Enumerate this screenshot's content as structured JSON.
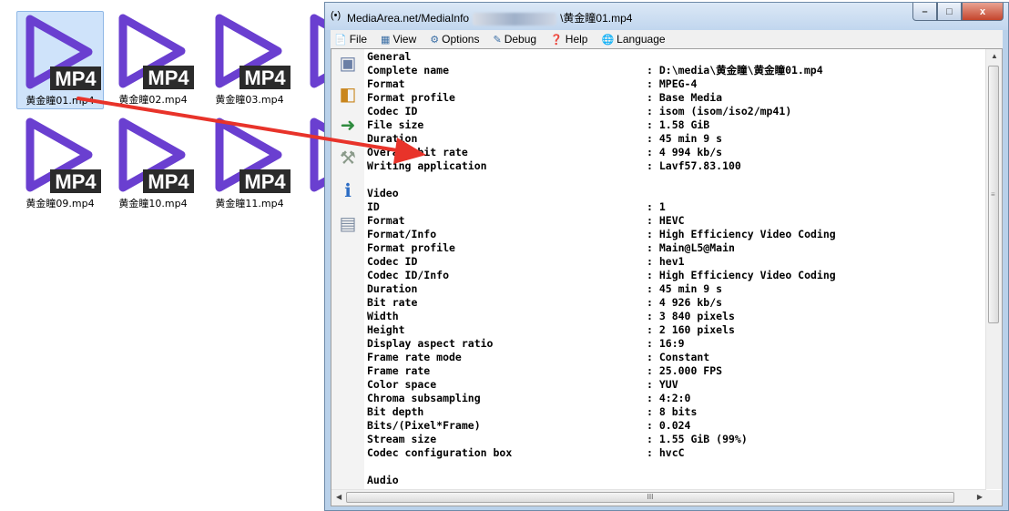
{
  "desktop": {
    "files": [
      {
        "name": "黄金瞳01.mp4",
        "badge": "MP4",
        "selected": true
      },
      {
        "name": "黄金瞳02.mp4",
        "badge": "MP4",
        "selected": false
      },
      {
        "name": "黄金瞳03.mp4",
        "badge": "MP4",
        "selected": false
      },
      {
        "name": "黄",
        "badge": "MP4",
        "selected": false
      },
      {
        "name": "黄金瞳09.mp4",
        "badge": "MP4",
        "selected": false
      },
      {
        "name": "黄金瞳10.mp4",
        "badge": "MP4",
        "selected": false
      },
      {
        "name": "黄金瞳11.mp4",
        "badge": "MP4",
        "selected": false
      },
      {
        "name": "黄",
        "badge": "MP4",
        "selected": false
      }
    ]
  },
  "window": {
    "title_prefix": "MediaArea.net/MediaInfo",
    "title_suffix": "\\黄金瞳01.mp4",
    "controls": {
      "minimize": "–",
      "maximize": "□",
      "close": "x"
    }
  },
  "menu": [
    {
      "label": "File",
      "icon": "file-icon"
    },
    {
      "label": "View",
      "icon": "view-icon"
    },
    {
      "label": "Options",
      "icon": "options-icon"
    },
    {
      "label": "Debug",
      "icon": "debug-icon"
    },
    {
      "label": "Help",
      "icon": "help-icon"
    },
    {
      "label": "Language",
      "icon": "language-icon"
    }
  ],
  "toolbar": [
    "open-file-icon",
    "open-folder-icon",
    "export-icon",
    "preferences-icon",
    "about-icon",
    "knowledge-base-icon"
  ],
  "info": {
    "sections": [
      {
        "header": "General",
        "rows": [
          {
            "label": "Complete name",
            "value": ": D:\\media\\黄金瞳\\黄金瞳01.mp4"
          },
          {
            "label": "Format",
            "value": ": MPEG-4"
          },
          {
            "label": "Format profile",
            "value": ": Base Media"
          },
          {
            "label": "Codec ID",
            "value": ": isom (isom/iso2/mp41)"
          },
          {
            "label": "File size",
            "value": ": 1.58 GiB"
          },
          {
            "label": "Duration",
            "value": ": 45 min 9 s"
          },
          {
            "label": "Overall bit rate",
            "value": ": 4 994 kb/s"
          },
          {
            "label": "Writing application",
            "value": ": Lavf57.83.100"
          }
        ]
      },
      {
        "header": "Video",
        "rows": [
          {
            "label": "ID",
            "value": ": 1"
          },
          {
            "label": "Format",
            "value": ": HEVC"
          },
          {
            "label": "Format/Info",
            "value": ": High Efficiency Video Coding"
          },
          {
            "label": "Format profile",
            "value": ": Main@L5@Main"
          },
          {
            "label": "Codec ID",
            "value": ": hev1"
          },
          {
            "label": "Codec ID/Info",
            "value": ": High Efficiency Video Coding"
          },
          {
            "label": "Duration",
            "value": ": 45 min 9 s"
          },
          {
            "label": "Bit rate",
            "value": ": 4 926 kb/s"
          },
          {
            "label": "Width",
            "value": ": 3 840 pixels"
          },
          {
            "label": "Height",
            "value": ": 2 160 pixels"
          },
          {
            "label": "Display aspect ratio",
            "value": ": 16:9"
          },
          {
            "label": "Frame rate mode",
            "value": ": Constant"
          },
          {
            "label": "Frame rate",
            "value": ": 25.000 FPS"
          },
          {
            "label": "Color space",
            "value": ": YUV"
          },
          {
            "label": "Chroma subsampling",
            "value": ": 4:2:0"
          },
          {
            "label": "Bit depth",
            "value": ": 8 bits"
          },
          {
            "label": "Bits/(Pixel*Frame)",
            "value": ": 0.024"
          },
          {
            "label": "Stream size",
            "value": ": 1.55 GiB (99%)"
          },
          {
            "label": "Codec configuration box",
            "value": ": hvcC"
          }
        ]
      },
      {
        "header": "Audio",
        "rows": []
      }
    ]
  },
  "scrollbar": {
    "h_grip": "III"
  },
  "colors": {
    "play_icon": "#6a3fd0",
    "badge_bg": "#2b2b2b",
    "annotation_arrow": "#e8332a",
    "close_button": "#c4452c"
  }
}
